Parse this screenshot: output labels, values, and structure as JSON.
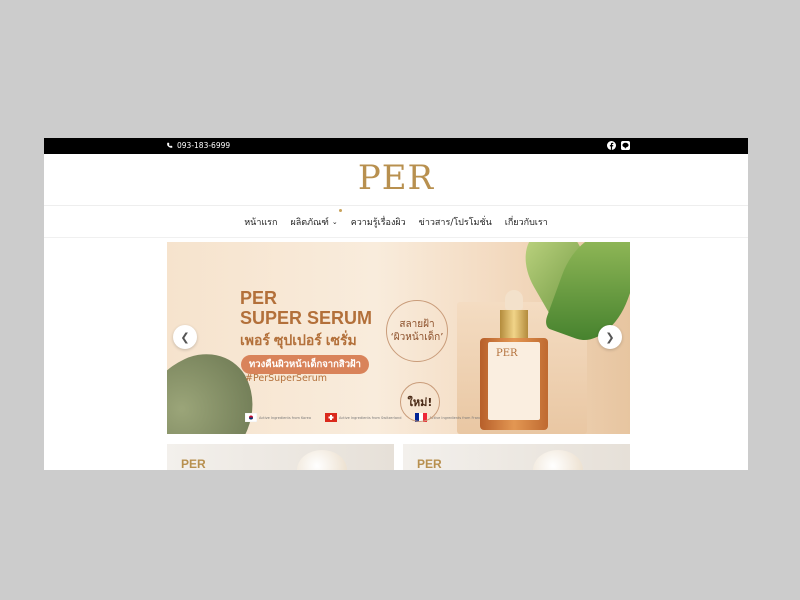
{
  "topbar": {
    "phone": "093-183-6999",
    "icons": [
      "facebook-icon",
      "line-icon"
    ]
  },
  "brand": {
    "logo": "PER",
    "color": "#b8904f"
  },
  "nav": {
    "items": [
      {
        "label": "หน้าแรก"
      },
      {
        "label": "ผลิตภัณฑ์",
        "dropdown": true
      },
      {
        "label": "ความรู้เรื่องผิว"
      },
      {
        "label": "ข่าวสาร/โปรโมชั่น"
      },
      {
        "label": "เกี่ยวกับเรา"
      }
    ],
    "active_marker_index": 1
  },
  "hero": {
    "line1": "PER",
    "line2": "SUPER SERUM",
    "line3": "เพอร์ ซุปเปอร์ เซรั่ม",
    "pill": "ทวงคืนผิวหน้าเด็กจากสิวฝ้า",
    "hashtag": "#PerSuperSerum",
    "circle_a": "สลายฝ้า",
    "circle_b": "‘ผิวหน้าเด็ก’",
    "new_badge": "ใหม่!",
    "bottle_logo": "PER",
    "flags": [
      {
        "text": "Active Ingredients from Korea"
      },
      {
        "text": "Active Ingredients from Switzerland"
      },
      {
        "text": "Active Ingredients from France"
      }
    ]
  },
  "cards": [
    {
      "logo": "PER"
    },
    {
      "logo": "PER"
    }
  ]
}
